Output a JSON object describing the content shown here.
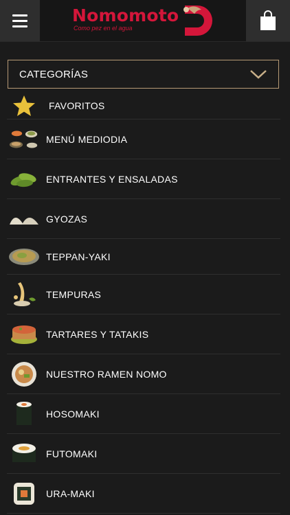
{
  "header": {
    "menu_icon": "hamburger-icon",
    "cart_icon": "shopping-bag-icon",
    "brand": {
      "name": "Nomomoto",
      "tagline": "Como pez en el agua",
      "color": "#d4163a"
    }
  },
  "dropdown": {
    "label": "CATEGORÍAS",
    "icon": "chevron-down-icon",
    "border_color": "#b89b76"
  },
  "categories": [
    {
      "label": "FAVORITOS",
      "icon": "star-icon"
    },
    {
      "label": "MENÚ MEDIODIA",
      "icon": "lunch-menu-thumbnail"
    },
    {
      "label": "ENTRANTES Y ENSALADAS",
      "icon": "edamame-thumbnail"
    },
    {
      "label": "GYOZAS",
      "icon": "gyoza-thumbnail"
    },
    {
      "label": "TEPPAN-YAKI",
      "icon": "teppanyaki-thumbnail"
    },
    {
      "label": "TEMPURAS",
      "icon": "tempura-thumbnail"
    },
    {
      "label": "TARTARES Y TATAKIS",
      "icon": "tartare-thumbnail"
    },
    {
      "label": "NUESTRO RAMEN NOMO",
      "icon": "ramen-thumbnail"
    },
    {
      "label": "HOSOMAKI",
      "icon": "hosomaki-thumbnail"
    },
    {
      "label": "FUTOMAKI",
      "icon": "futomaki-thumbnail"
    },
    {
      "label": "URA-MAKI",
      "icon": "uramaki-thumbnail"
    }
  ]
}
